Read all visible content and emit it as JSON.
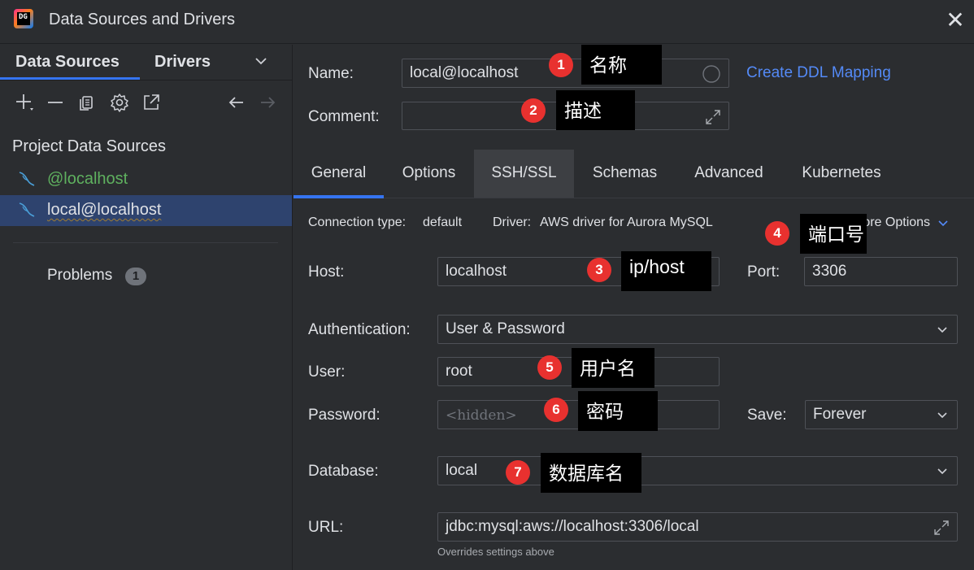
{
  "window": {
    "title": "Data Sources and Drivers",
    "close_glyph": "✕"
  },
  "left": {
    "tabs": [
      "Data Sources",
      "Drivers"
    ],
    "section_title": "Project Data Sources",
    "data_sources": [
      {
        "label": "@localhost"
      },
      {
        "label": "local@localhost"
      }
    ],
    "problems_label": "Problems",
    "problems_count": "1"
  },
  "form": {
    "name_label": "Name:",
    "name_value": "local@localhost",
    "create_ddl_link": "Create DDL Mapping",
    "comment_label": "Comment:",
    "comment_value": ""
  },
  "tabs": [
    "General",
    "Options",
    "SSH/SSL",
    "Schemas",
    "Advanced",
    "Kubernetes"
  ],
  "general": {
    "connection_type_label": "Connection type:",
    "connection_type_value": "default",
    "driver_label": "Driver:",
    "driver_value": "AWS driver for Aurora MySQL",
    "more_options": "More Options",
    "host_label": "Host:",
    "host_value": "localhost",
    "port_label": "Port:",
    "port_value": "3306",
    "auth_label": "Authentication:",
    "auth_value": "User & Password",
    "user_label": "User:",
    "user_value": "root",
    "password_label": "Password:",
    "password_placeholder": "<hidden>",
    "save_label": "Save:",
    "save_value": "Forever",
    "database_label": "Database:",
    "database_value": "local",
    "url_label": "URL:",
    "url_value": "jdbc:mysql:aws://localhost:3306/local",
    "url_hint": "Overrides settings above"
  },
  "annotations": [
    {
      "num": "1",
      "text": "名称"
    },
    {
      "num": "2",
      "text": "描述"
    },
    {
      "num": "3",
      "text": "ip/host"
    },
    {
      "num": "4",
      "text": "端口号"
    },
    {
      "num": "5",
      "text": "用户名"
    },
    {
      "num": "6",
      "text": "密码"
    },
    {
      "num": "7",
      "text": "数据库名"
    }
  ],
  "colors": {
    "background": "#2b2d30",
    "accent": "#3574f0",
    "link": "#548af7",
    "selection": "#2e436e",
    "ds_active_green": "#5fb15f",
    "annotation_red": "#e8312f"
  },
  "icons": [
    "app-icon",
    "close-icon",
    "add-icon",
    "remove-icon",
    "copy-icon",
    "settings-icon",
    "export-icon",
    "back-arrow-icon",
    "forward-arrow-icon",
    "mysql-icon",
    "chevron-down-icon",
    "expand-icon"
  ]
}
